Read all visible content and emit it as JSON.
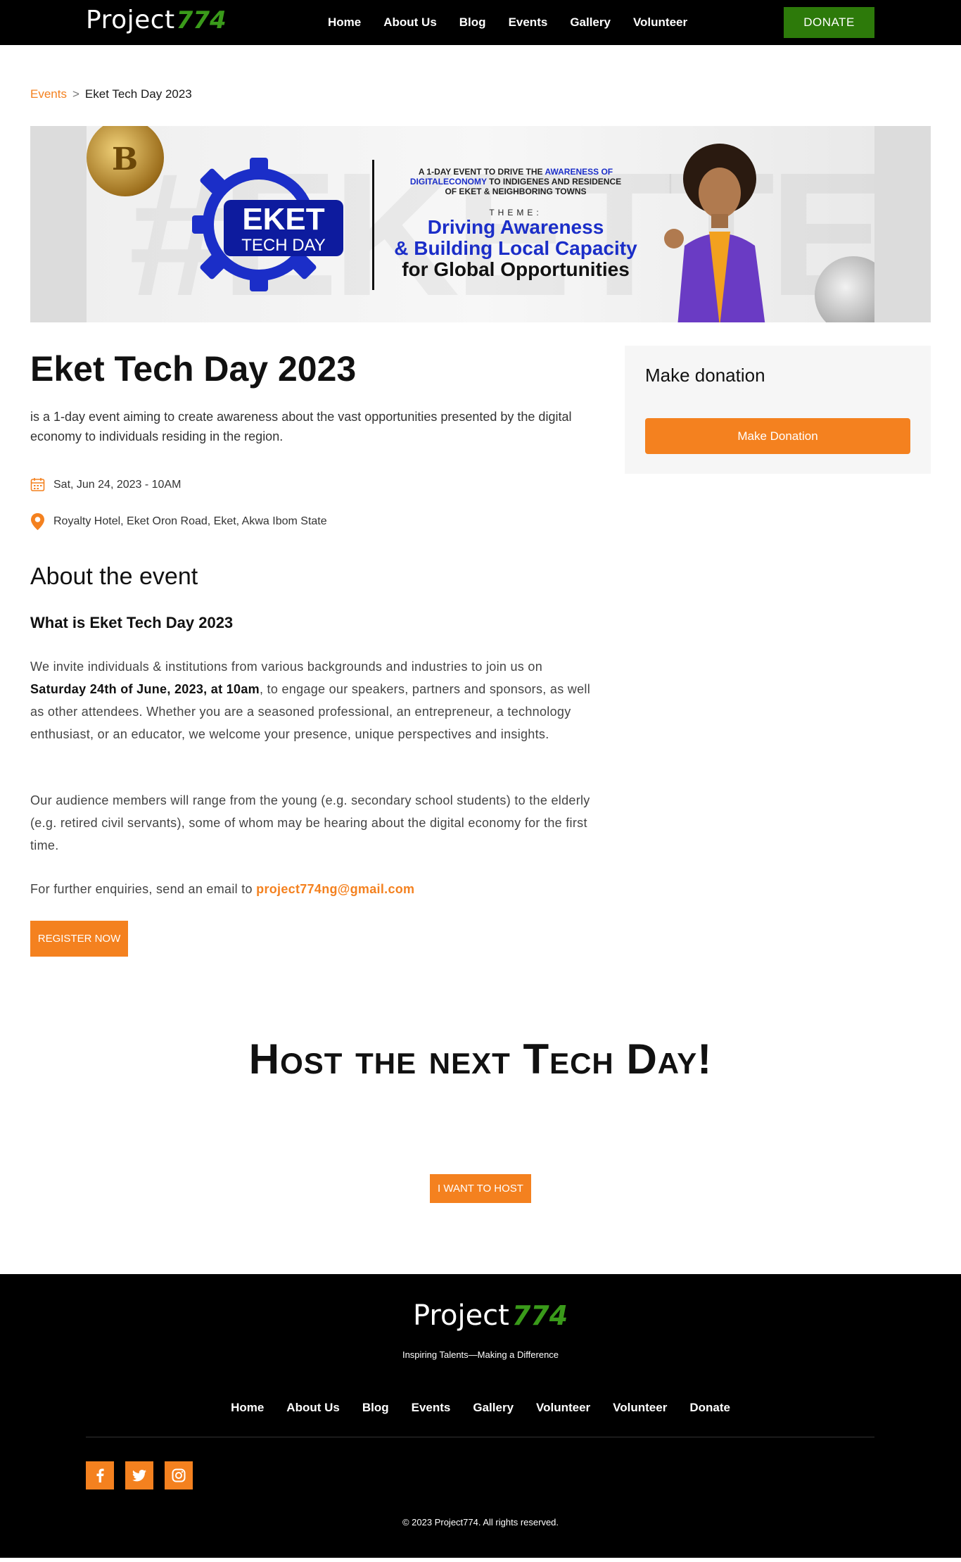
{
  "header": {
    "logo_word": "Project",
    "logo_number": "774",
    "nav": [
      "Home",
      "About Us",
      "Blog",
      "Events",
      "Gallery",
      "Volunteer"
    ],
    "donate_label": "DONATE"
  },
  "breadcrumb": {
    "parent": "Events",
    "separator": ">",
    "current": "Eket Tech Day 2023"
  },
  "banner": {
    "logo_top": "EKET",
    "logo_bottom": "TECH DAY",
    "small_line1": "A 1-DAY EVENT TO DRIVE THE",
    "small_highlight1": "AWARENESS OF",
    "small_highlight2": "DIGITALECONOMY",
    "small_line2": "TO INDIGENES AND RESIDENCE",
    "small_line3": "OF EKET & NEIGHBORING TOWNS",
    "theme_label": "THEME:",
    "theme_line1": "Driving Awareness",
    "theme_line2": "& Building Local Capacity",
    "theme_line3": "for Global Opportunities"
  },
  "event": {
    "title": "Eket Tech Day 2023",
    "summary": "is a 1-day event aiming to create awareness about the vast opportunities presented by the digital economy to individuals residing in the region.",
    "date": "Sat, Jun 24, 2023 - 10AM",
    "location": "Royalty Hotel, Eket Oron Road, Eket, Akwa Ibom State",
    "about_heading": "About the event",
    "what_heading": "What is Eket Tech Day 2023",
    "p1_before": "We invite individuals & institutions from various backgrounds and industries to join us on ",
    "p1_bold": "Saturday 24th of June, 2023, at 10am",
    "p1_after": ", to engage our speakers, partners and sponsors, as well as other attendees. Whether you are a seasoned professional, an entrepreneur, a technology enthusiast, or an educator, we welcome your presence, unique perspectives and insights.",
    "p2": "Our audience members will range from the young (e.g. secondary school students) to the elderly (e.g. retired civil servants), some of whom may be hearing about the digital economy for the first time.",
    "p3_before": "For further enquiries, send an email to ",
    "p3_email": "project774ng@gmail.com",
    "register_label": "REGISTER NOW"
  },
  "sidebar": {
    "donation_title": "Make donation",
    "donation_button": "Make Donation"
  },
  "host": {
    "heading": "Host the next Tech Day!",
    "button": "I WANT TO HOST"
  },
  "footer": {
    "logo_word": "Project",
    "logo_number": "774",
    "tagline": "Inspiring Talents—Making a Difference",
    "nav": [
      "Home",
      "About Us",
      "Blog",
      "Events",
      "Gallery",
      "Volunteer",
      "Volunteer",
      "Donate"
    ],
    "social": [
      "facebook-icon",
      "twitter-icon",
      "instagram-icon"
    ],
    "copyright": "© 2023 Project774. All rights reserved."
  },
  "colors": {
    "accent": "#f4811f",
    "brand_green": "#2d7a0a",
    "banner_blue": "#1b2ec8"
  }
}
